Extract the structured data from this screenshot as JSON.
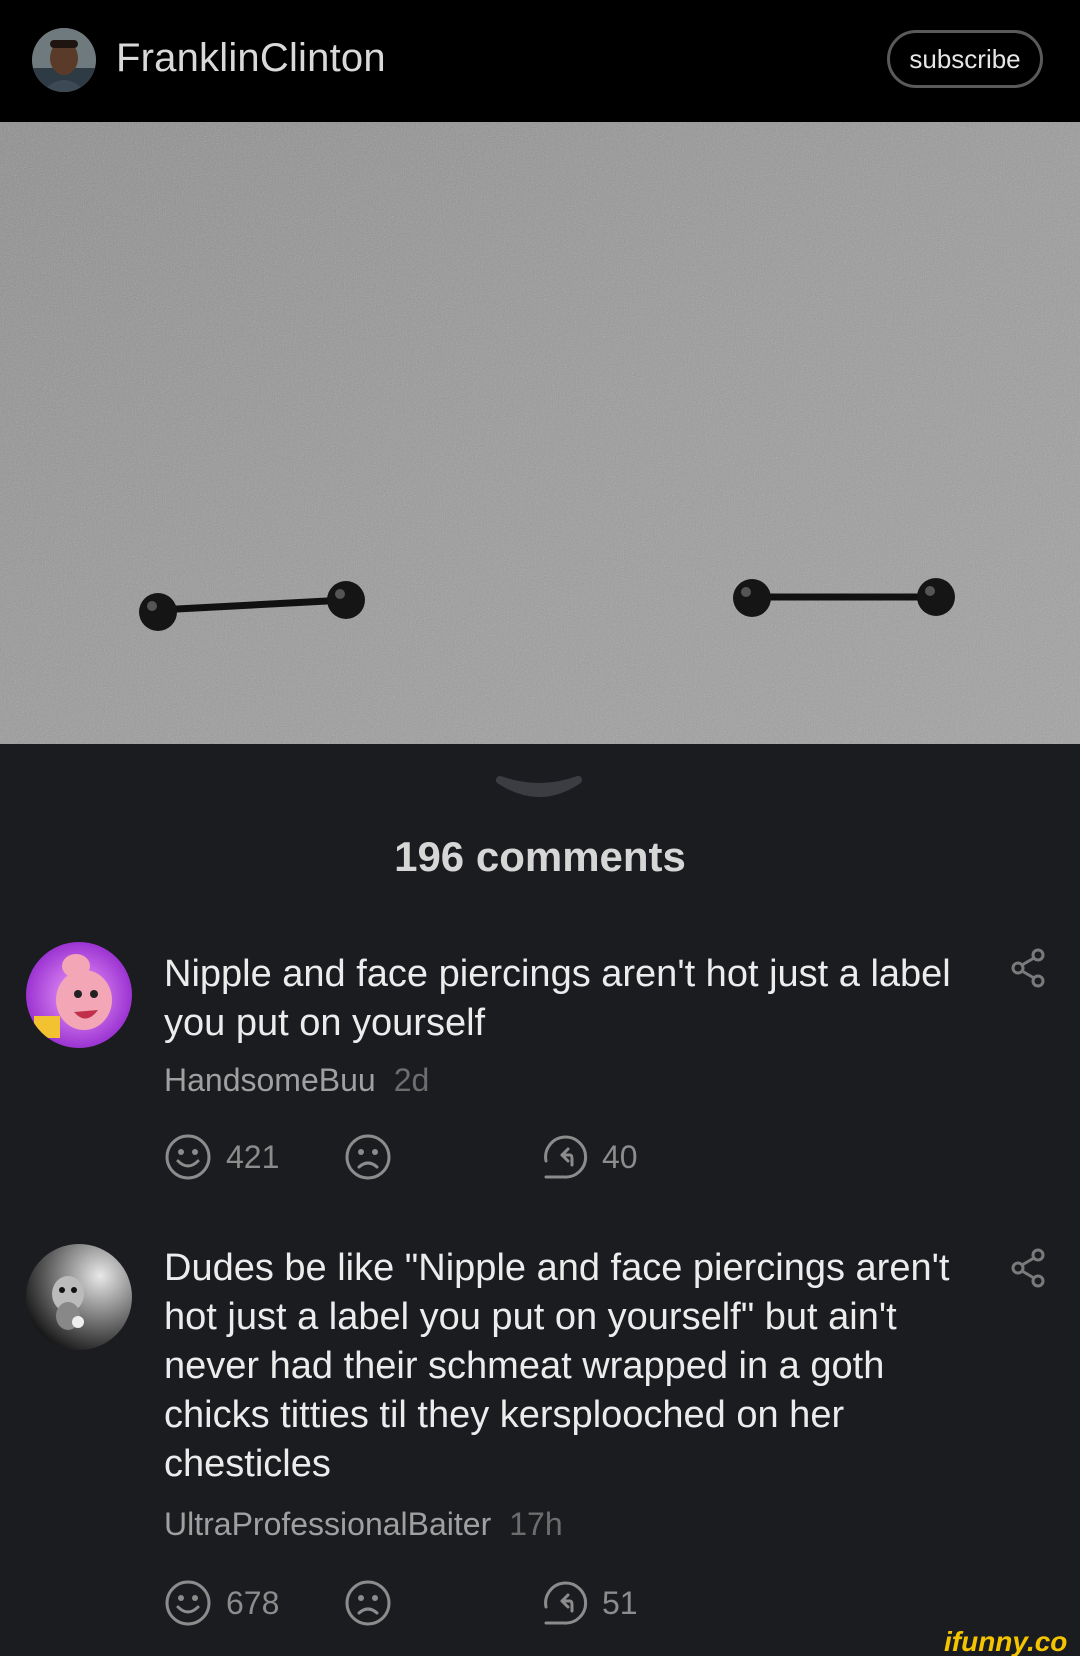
{
  "header": {
    "username": "FranklinClinton",
    "avatar_icon": "user-avatar",
    "subscribe_label": "subscribe"
  },
  "post": {
    "image_description_icon": "image"
  },
  "comments_section": {
    "count_label": "196 comments"
  },
  "comments": [
    {
      "text": "Nipple and face piercings aren't hot just a label you put on yourself",
      "author": "HandsomeBuu",
      "time": "2d",
      "smiles": "421",
      "replies": "40"
    },
    {
      "text": "Dudes be like \"Nipple and face piercings aren't hot just a label you put on yourself\" but ain't never had their schmeat wrapped in a goth chicks titties til they kersplooched on her chesticles",
      "author": "UltraProfessionalBaiter",
      "time": "17h",
      "smiles": "678",
      "replies": "51"
    }
  ],
  "watermark": "ifunny.co",
  "colors": {
    "background": "#1b1c20",
    "header": "#000000",
    "watermark": "#f5c400"
  }
}
